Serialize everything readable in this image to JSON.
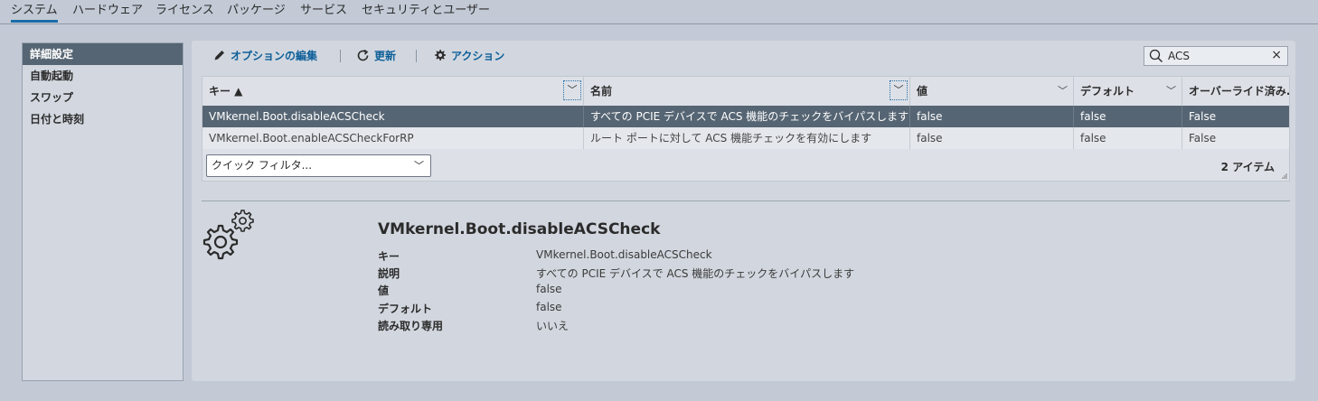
{
  "tabs": [
    {
      "label": "システム",
      "active": true
    },
    {
      "label": "ハードウェア",
      "active": false
    },
    {
      "label": "ライセンス",
      "active": false
    },
    {
      "label": "パッケージ",
      "active": false
    },
    {
      "label": "サービス",
      "active": false
    },
    {
      "label": "セキュリティとユーザー",
      "active": false
    }
  ],
  "sidebar": {
    "items": [
      {
        "label": "詳細設定",
        "selected": true
      },
      {
        "label": "自動起動",
        "selected": false
      },
      {
        "label": "スワップ",
        "selected": false
      },
      {
        "label": "日付と時刻",
        "selected": false
      }
    ]
  },
  "toolbar": {
    "edit_label": "オプションの編集",
    "refresh_label": "更新",
    "actions_label": "アクション",
    "search_value": "ACS"
  },
  "grid": {
    "columns": [
      {
        "label": "キー ▲"
      },
      {
        "label": "名前"
      },
      {
        "label": "値"
      },
      {
        "label": "デフォルト"
      },
      {
        "label": "オーバーライド済み..."
      }
    ],
    "rows": [
      {
        "key": "VMkernel.Boot.disableACSCheck",
        "name": "すべての PCIE デバイスで ACS 機能のチェックをバイパスします",
        "value": "false",
        "default": "false",
        "overridden": "False",
        "selected": true
      },
      {
        "key": "VMkernel.Boot.enableACSCheckForRP",
        "name": "ルート ポートに対して ACS 機能チェックを有効にします",
        "value": "false",
        "default": "false",
        "overridden": "False",
        "selected": false
      }
    ],
    "quick_filter": "クイック フィルタ...",
    "item_count": "2 アイテム"
  },
  "details": {
    "title": "VMkernel.Boot.disableACSCheck",
    "fields": [
      {
        "label": "キー",
        "value": "VMkernel.Boot.disableACSCheck"
      },
      {
        "label": "説明",
        "value": "すべての PCIE デバイスで ACS 機能のチェックをバイパスします"
      },
      {
        "label": "値",
        "value": "false"
      },
      {
        "label": "デフォルト",
        "value": "false"
      },
      {
        "label": "読み取り専用",
        "value": "いいえ"
      }
    ]
  },
  "icons": {
    "edit": "pencil-icon",
    "refresh": "refresh-icon",
    "actions": "gear-icon",
    "search": "search-icon",
    "clear": "close-icon",
    "detail": "gears-icon"
  },
  "colors": {
    "accent": "#0d5f99",
    "selected_row": "#566573",
    "tab_underline": "#1b6ca8"
  }
}
